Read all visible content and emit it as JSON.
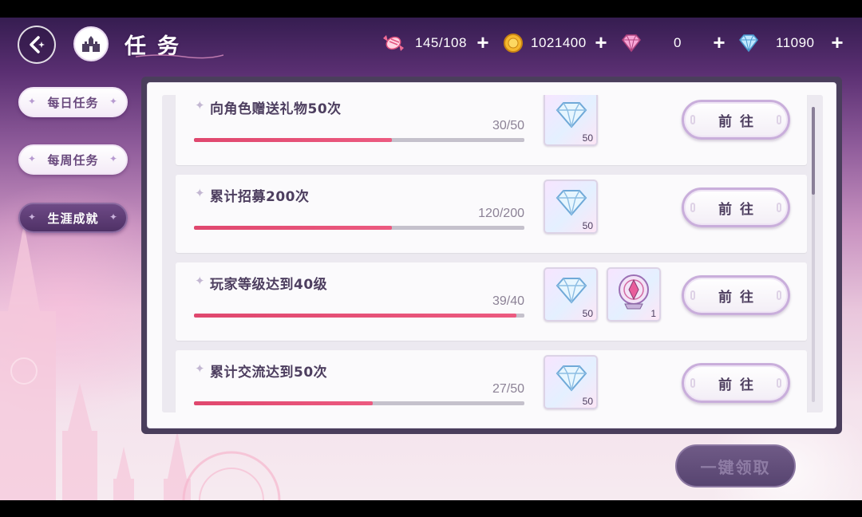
{
  "header": {
    "title": "任务",
    "back_icon": "back-arrow-icon",
    "home_icon": "castle-home-icon"
  },
  "resources": [
    {
      "name": "candy",
      "icon": "candy-icon",
      "value": "145/108"
    },
    {
      "name": "gold",
      "icon": "gold-coin-icon",
      "value": "1021400"
    },
    {
      "name": "pink_diamond",
      "icon": "pink-diamond-icon",
      "value": "0"
    },
    {
      "name": "blue_diamond",
      "icon": "blue-diamond-icon",
      "value": "11090"
    }
  ],
  "plus_label": "+",
  "side_tabs": [
    {
      "label": "每日任务",
      "active": false
    },
    {
      "label": "每周任务",
      "active": false
    },
    {
      "label": "生涯成就",
      "active": true
    }
  ],
  "tasks": [
    {
      "title": "向角色赠送礼物50次",
      "progress": "30/50",
      "fraction": 0.6,
      "rewards": [
        {
          "icon": "diamond-icon",
          "count": "50"
        }
      ],
      "button": "前往"
    },
    {
      "title": "累计招募200次",
      "progress": "120/200",
      "fraction": 0.6,
      "rewards": [
        {
          "icon": "diamond-icon",
          "count": "50"
        }
      ],
      "button": "前往"
    },
    {
      "title": "玩家等级达到40级",
      "progress": "39/40",
      "fraction": 0.975,
      "rewards": [
        {
          "icon": "diamond-icon",
          "count": "50"
        },
        {
          "icon": "crystal-orb-icon",
          "count": "1"
        }
      ],
      "button": "前往"
    },
    {
      "title": "累计交流达到50次",
      "progress": "27/50",
      "fraction": 0.54,
      "rewards": [
        {
          "icon": "diamond-icon",
          "count": "50"
        }
      ],
      "button": "前往"
    }
  ],
  "claim_all_label": "一键领取",
  "colors": {
    "accent_pink": "#e0476e",
    "panel_frame": "#4a3e5c",
    "active_tab": "#5a3c72"
  }
}
